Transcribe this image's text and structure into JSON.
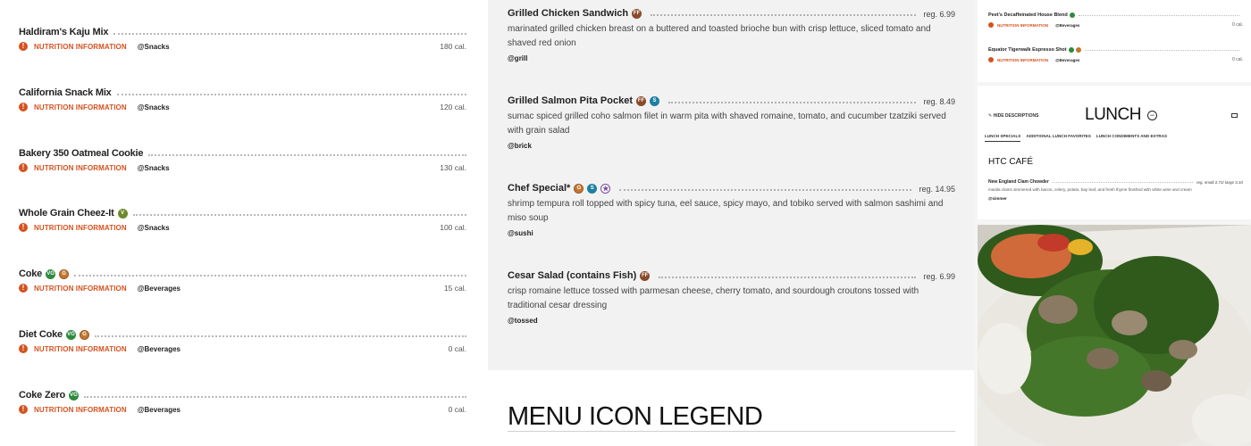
{
  "left_items": [
    {
      "name": "Haldiram's Kaju Mix",
      "badges": [],
      "nutrition_label": "NUTRITION INFORMATION",
      "category": "@Snacks",
      "calories": "180 cal."
    },
    {
      "name": "California Snack Mix",
      "badges": [],
      "nutrition_label": "NUTRITION INFORMATION",
      "category": "@Snacks",
      "calories": "120 cal."
    },
    {
      "name": "Bakery 350 Oatmeal Cookie",
      "badges": [],
      "nutrition_label": "NUTRITION INFORMATION",
      "category": "@Snacks",
      "calories": "130 cal."
    },
    {
      "name": "Whole Grain Cheez-It",
      "badges": [
        "V"
      ],
      "nutrition_label": "NUTRITION INFORMATION",
      "category": "@Snacks",
      "calories": "100 cal."
    },
    {
      "name": "Coke",
      "badges": [
        "VG",
        "G"
      ],
      "nutrition_label": "NUTRITION INFORMATION",
      "category": "@Beverages",
      "calories": "15 cal."
    },
    {
      "name": "Diet Coke",
      "badges": [
        "VG",
        "G"
      ],
      "nutrition_label": "NUTRITION INFORMATION",
      "category": "@Beverages",
      "calories": "0 cal."
    },
    {
      "name": "Coke Zero",
      "badges": [
        "VG"
      ],
      "nutrition_label": "NUTRITION INFORMATION",
      "category": "@Beverages",
      "calories": "0 cal."
    }
  ],
  "mid_items": [
    {
      "name": "Grilled Chicken Sandwich",
      "badges": [
        "FF"
      ],
      "price": "reg.  6.99",
      "description": "marinated grilled chicken breast on a buttered and toasted brioche bun with crisp lettuce, sliced tomato and shaved red onion",
      "station": "@grill"
    },
    {
      "name": "Grilled Salmon Pita Pocket",
      "badges": [
        "FF",
        "S"
      ],
      "price": "reg.  8.49",
      "description": "sumac spiced grilled coho salmon filet in warm pita with shaved romaine, tomato, and cucumber tzatziki served with grain salad",
      "station": "@brick"
    },
    {
      "name": "Chef Special*",
      "badges": [
        "G",
        "S",
        "★"
      ],
      "price": "reg.  14.95",
      "description": "shrimp tempura roll topped with spicy tuna, eel sauce, spicy mayo, and tobiko served with salmon sashimi and miso soup",
      "station": "@sushi"
    },
    {
      "name": "Cesar Salad (contains Fish)",
      "badges": [
        "FF"
      ],
      "price": "reg.  6.99",
      "description": "crisp romaine lettuce tossed with parmesan cheese, cherry tomato, and sourdough croutons tossed with traditional cesar dressing",
      "station": "@tossed"
    }
  ],
  "legend": {
    "title": "MENU ICON LEGEND"
  },
  "right_top_items": [
    {
      "name": "Peet's Decaffeinated House Blend",
      "nutrition_label": "NUTRITION INFORMATION",
      "category": "@Beverages",
      "calories": "0 cal."
    },
    {
      "name": "Equator Tigerwalk Espresso Shot",
      "nutrition_label": "NUTRITION INFORMATION",
      "category": "@Beverages",
      "calories": "0 cal."
    }
  ],
  "lunch": {
    "hide_label": "HIDE DESCRIPTIONS",
    "title": "LUNCH",
    "toggle": "−",
    "tabs": [
      "LUNCH SPECIALS",
      "ADDITIONAL LUNCH FAVORITES",
      "LUNCH CONDIMENTS AND EXTRAS"
    ],
    "section": "HTC CAFÉ",
    "item": {
      "name": "New England Clam Chowder",
      "price": "reg.  small 2.72/ large 3.10",
      "description": "manila clams simmered with bacon, celery, potato, bay leaf, and fresh thyme finished with white wine and cream",
      "station": "@simmer"
    }
  },
  "badge_colors": {
    "V": "#6f8a2a",
    "VG": "#2e8a3e",
    "G": "#c2772f",
    "FF": "#8a4a2a",
    "S": "#1d7fa1",
    "★": "#7a4aa3"
  },
  "icons": {
    "info": "info-icon",
    "email": "email-icon",
    "collapse": "minus-circle-icon",
    "hide": "hide-descriptions-icon"
  }
}
